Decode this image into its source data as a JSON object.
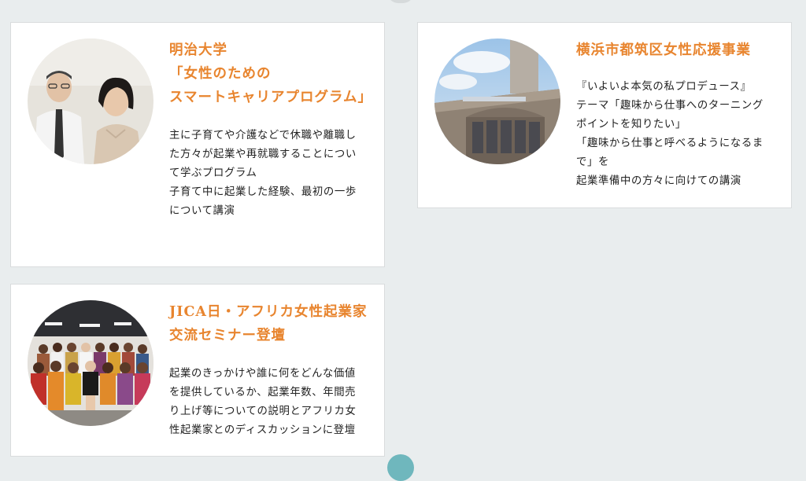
{
  "cards": [
    {
      "title_lines": [
        "明治大学",
        "「女性のための",
        "スマートキャリアプログラム」"
      ],
      "desc_lines": [
        "主に子育てや介護などで休職や離職し",
        "た方々が起業や再就職することについ",
        "て学ぶプログラム",
        "子育て中に起業した経験、最初の一歩",
        "について講演"
      ]
    },
    {
      "title_lines": [
        "横浜市都筑区女性応援事業"
      ],
      "desc_lines": [
        "『いよいよ本気の私プロデュース』",
        "テーマ「趣味から仕事へのターニング",
        "ポイントを知りたい」",
        "「趣味から仕事と呼べるようになるま",
        "で」を",
        "起業準備中の方々に向けての講演"
      ]
    },
    {
      "title_lines": [
        "JICA日・アフリカ女性起業家",
        "交流セミナー登壇"
      ],
      "desc_lines": [
        "起業のきっかけや誰に何をどんな価値",
        "を提供しているか、起業年数、年間売",
        "り上げ等についての説明とアフリカ女",
        "性起業家とのディスカッションに登壇"
      ]
    }
  ],
  "colors": {
    "accent": "#e8852f",
    "background": "#e9edee",
    "card": "#ffffff",
    "scroll_dot": "#6fb7bd"
  }
}
